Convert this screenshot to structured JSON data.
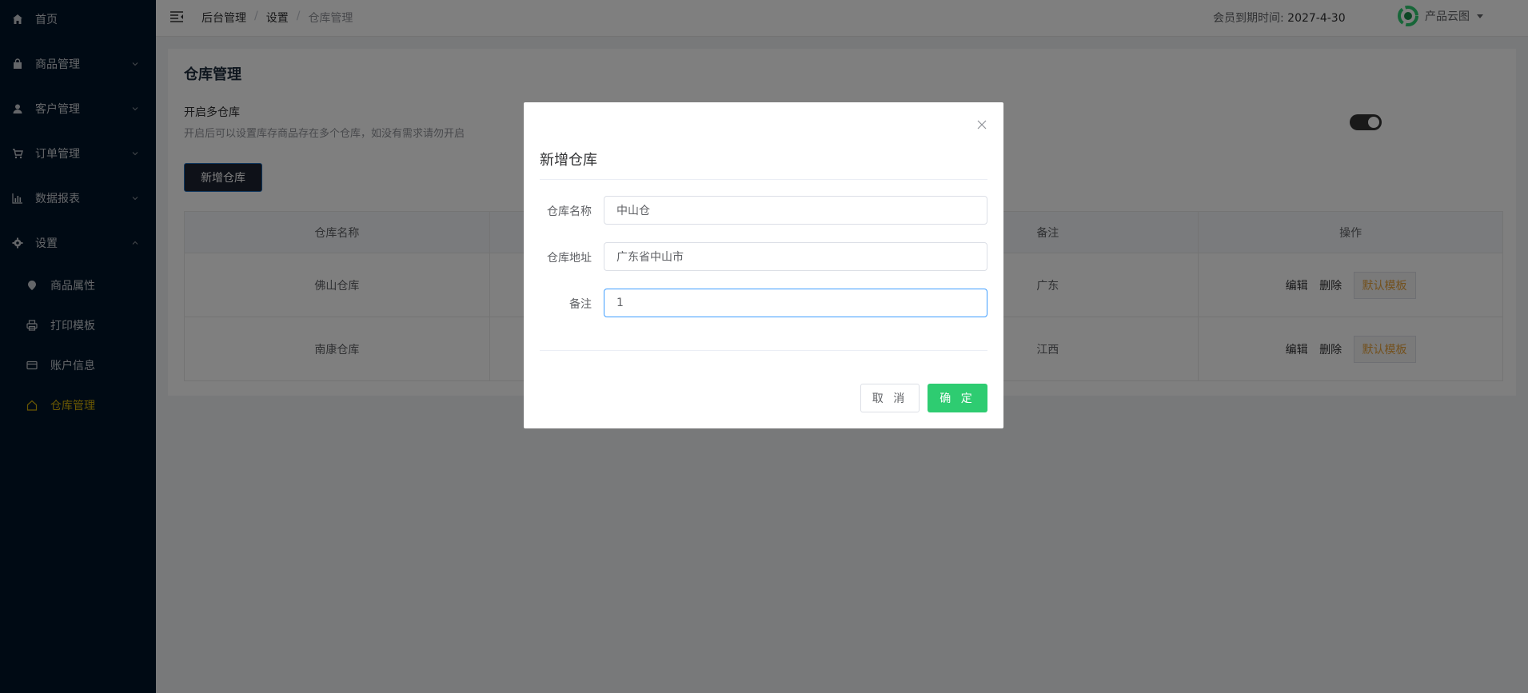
{
  "sidebar": {
    "items": [
      {
        "label": "首页",
        "icon": "home-icon"
      },
      {
        "label": "商品管理",
        "icon": "bag-icon"
      },
      {
        "label": "客户管理",
        "icon": "user-icon"
      },
      {
        "label": "订单管理",
        "icon": "cart-icon"
      },
      {
        "label": "数据报表",
        "icon": "chart-icon"
      },
      {
        "label": "设置",
        "icon": "gear-icon"
      }
    ],
    "sub_items": [
      {
        "label": "商品属性",
        "icon": "tag-icon"
      },
      {
        "label": "打印模板",
        "icon": "printer-icon"
      },
      {
        "label": "账户信息",
        "icon": "card-icon"
      },
      {
        "label": "仓库管理",
        "icon": "house-icon"
      }
    ],
    "active_color": "#d4b106"
  },
  "header": {
    "breadcrumb": [
      "后台管理",
      "设置",
      "仓库管理"
    ],
    "expire_label": "会员到期时间:",
    "expire_value": "2027-4-30",
    "user_name": "产品云图"
  },
  "main": {
    "title": "仓库管理",
    "option_title": "开启多仓库",
    "option_desc": "开启后可以设置库存商品存在多个仓库，如没有需求请勿开启",
    "add_button": "新增仓库",
    "table": {
      "headers": [
        "仓库名称",
        "",
        "备注",
        "操作"
      ],
      "rows": [
        {
          "name": "佛山仓库",
          "note": "广东"
        },
        {
          "name": "南康仓库",
          "note": "江西"
        }
      ],
      "edit_label": "编辑",
      "delete_label": "删除",
      "default_label": "默认模板"
    }
  },
  "dialog": {
    "title": "新增仓库",
    "fields": [
      {
        "label": "仓库名称",
        "value": "中山仓"
      },
      {
        "label": "仓库地址",
        "value": "广东省中山市"
      },
      {
        "label": "备注",
        "value": "1"
      }
    ],
    "cancel_label": "取 消",
    "ok_label": "确 定",
    "ok_color": "#2ecc71"
  }
}
